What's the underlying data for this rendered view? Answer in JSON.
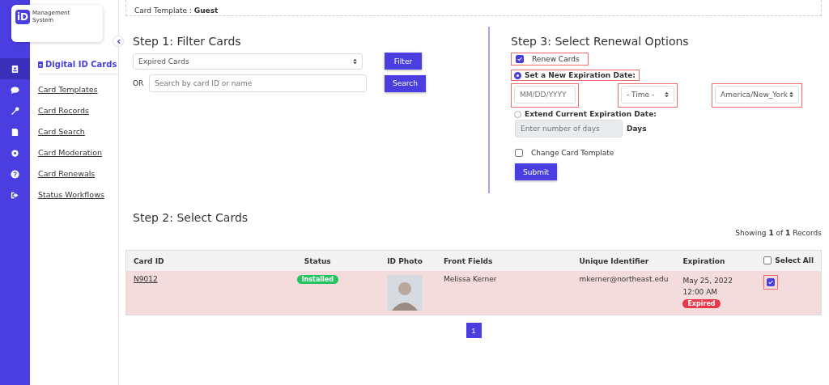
{
  "logo": {
    "mark": "iD",
    "text": "Management System"
  },
  "rail": [
    {
      "selected": true
    },
    {
      "selected": false
    },
    {
      "selected": false
    },
    {
      "selected": false
    },
    {
      "selected": false
    },
    {
      "selected": false
    },
    {
      "selected": false
    }
  ],
  "sidebar": {
    "heading": "Digital ID Cards",
    "items": [
      "Card Templates",
      "Card Records",
      "Card Search",
      "Card Moderation",
      "Card Renewals",
      "Status Workflows"
    ]
  },
  "template_bar": {
    "label": "Card Template : ",
    "value": "Guest"
  },
  "step1": {
    "title": "Step 1: Filter Cards",
    "filter_select": "Expired Cards",
    "filter_button": "Filter",
    "or_label": "OR",
    "search": {
      "placeholder": "Search by card ID or name"
    },
    "search_button": "Search"
  },
  "step3": {
    "title": "Step 3: Select Renewal Options",
    "renew": {
      "label": "Renew Cards",
      "checked": true,
      "highlighted": true
    },
    "options": [
      {
        "label": "Set a New Expiration Date:",
        "selected": true,
        "highlighted": true
      },
      {
        "label": "Extend Current Expiration Date:",
        "selected": false,
        "highlighted": false
      }
    ],
    "date": {
      "placeholder": "MM/DD/YYYY",
      "highlighted": true
    },
    "time": {
      "value": "- Time -",
      "highlighted": true
    },
    "timezone": {
      "value": "America/New_York",
      "highlighted": true
    },
    "days": {
      "placeholder": "Enter number of days",
      "disabled": true
    },
    "days_label": "Days",
    "change_template": {
      "label": "Change Card Template",
      "checked": false
    },
    "submit": "Submit"
  },
  "step2": {
    "title": "Step 2: Select Cards",
    "showing": "Showing **1** of **1** Records"
  },
  "table": {
    "columns": [
      "Card ID",
      "Status",
      "ID Photo",
      "Front Fields",
      "Unique Identifier",
      "Expiration"
    ],
    "select_all": {
      "label": "Select All",
      "checked": false
    },
    "rows": [
      {
        "card_id": "N9012",
        "status": "Installed",
        "front_fields": "Melissa Kerner",
        "identifier": "mkerner@northeast.edu",
        "expiration": "May 25, 2022 12:00 AM",
        "expired_badge": "Expired",
        "checked": true,
        "highlighted": true
      }
    ]
  },
  "pagination": [
    {
      "label": "1",
      "selected": true
    }
  ]
}
